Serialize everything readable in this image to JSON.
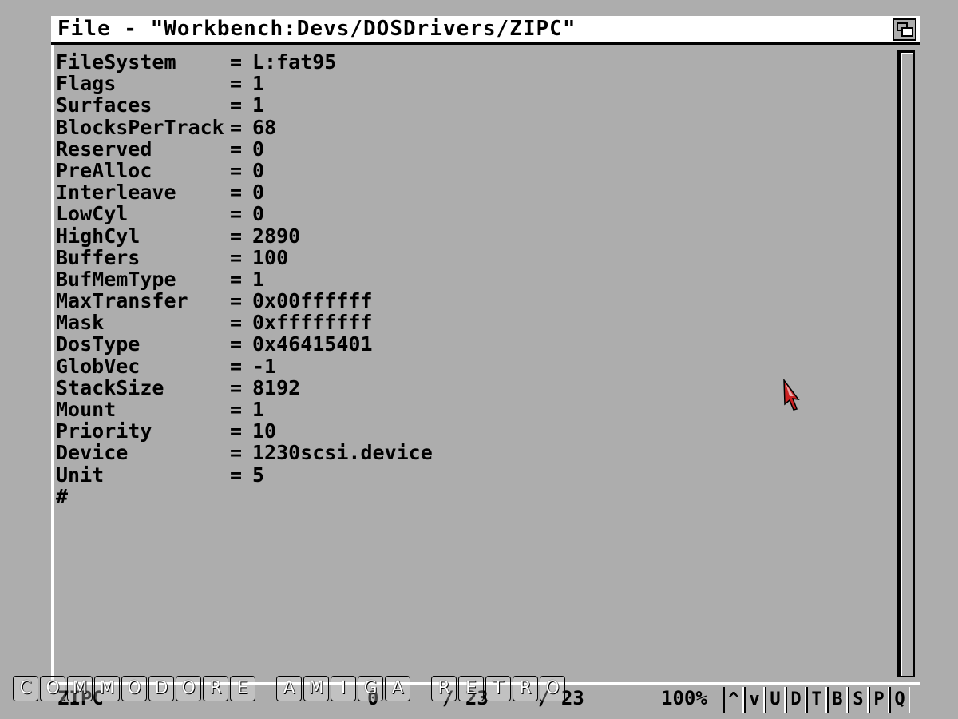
{
  "window": {
    "title": "File - \"Workbench:Devs/DOSDrivers/ZIPC\"",
    "depth_gadget_icon": "depth-arrange-icon"
  },
  "lines": [
    {
      "key": "FileSystem",
      "eq": "=",
      "value": "L:fat95"
    },
    {
      "key": "Flags",
      "eq": "=",
      "value": "1"
    },
    {
      "key": "Surfaces",
      "eq": "=",
      "value": "1"
    },
    {
      "key": "BlocksPerTrack",
      "eq": "=",
      "value": "68"
    },
    {
      "key": "Reserved",
      "eq": "=",
      "value": "0"
    },
    {
      "key": "PreAlloc",
      "eq": "=",
      "value": "0"
    },
    {
      "key": "Interleave",
      "eq": "=",
      "value": "0"
    },
    {
      "key": "LowCyl",
      "eq": "=",
      "value": "0"
    },
    {
      "key": "HighCyl",
      "eq": "=",
      "value": "2890"
    },
    {
      "key": "Buffers",
      "eq": "=",
      "value": "100"
    },
    {
      "key": "BufMemType",
      "eq": "=",
      "value": "1"
    },
    {
      "key": "MaxTransfer",
      "eq": "=",
      "value": "0x00ffffff"
    },
    {
      "key": "Mask",
      "eq": "=",
      "value": "0xffffffff"
    },
    {
      "key": "DosType",
      "eq": "=",
      "value": "0x46415401"
    },
    {
      "key": "GlobVec",
      "eq": "=",
      "value": "-1"
    },
    {
      "key": "StackSize",
      "eq": "=",
      "value": "8192"
    },
    {
      "key": "Mount",
      "eq": "=",
      "value": "1"
    },
    {
      "key": "Priority",
      "eq": "=",
      "value": "10"
    },
    {
      "key": "Device",
      "eq": "=",
      "value": "1230scsi.device"
    },
    {
      "key": "Unit",
      "eq": "=",
      "value": "5"
    },
    {
      "key": "#",
      "eq": "",
      "value": ""
    }
  ],
  "status": {
    "name": "ZIPC",
    "col": "0",
    "line": "/ 23",
    "total": "/ 23",
    "zoom": "100%"
  },
  "buttons": [
    "^",
    "v",
    "U",
    "D",
    "T",
    "B",
    "S",
    "P",
    "Q"
  ],
  "watermark": [
    "C",
    "O",
    "M",
    "M",
    "O",
    "D",
    "O",
    "R",
    "E",
    " ",
    "A",
    "M",
    "I",
    "G",
    "A",
    " ",
    "R",
    "E",
    "T",
    "R",
    "O"
  ],
  "colors": {
    "background": "#adadad",
    "titlebar": "#ffffff",
    "text": "#000000",
    "pointer": "#cc2222"
  }
}
